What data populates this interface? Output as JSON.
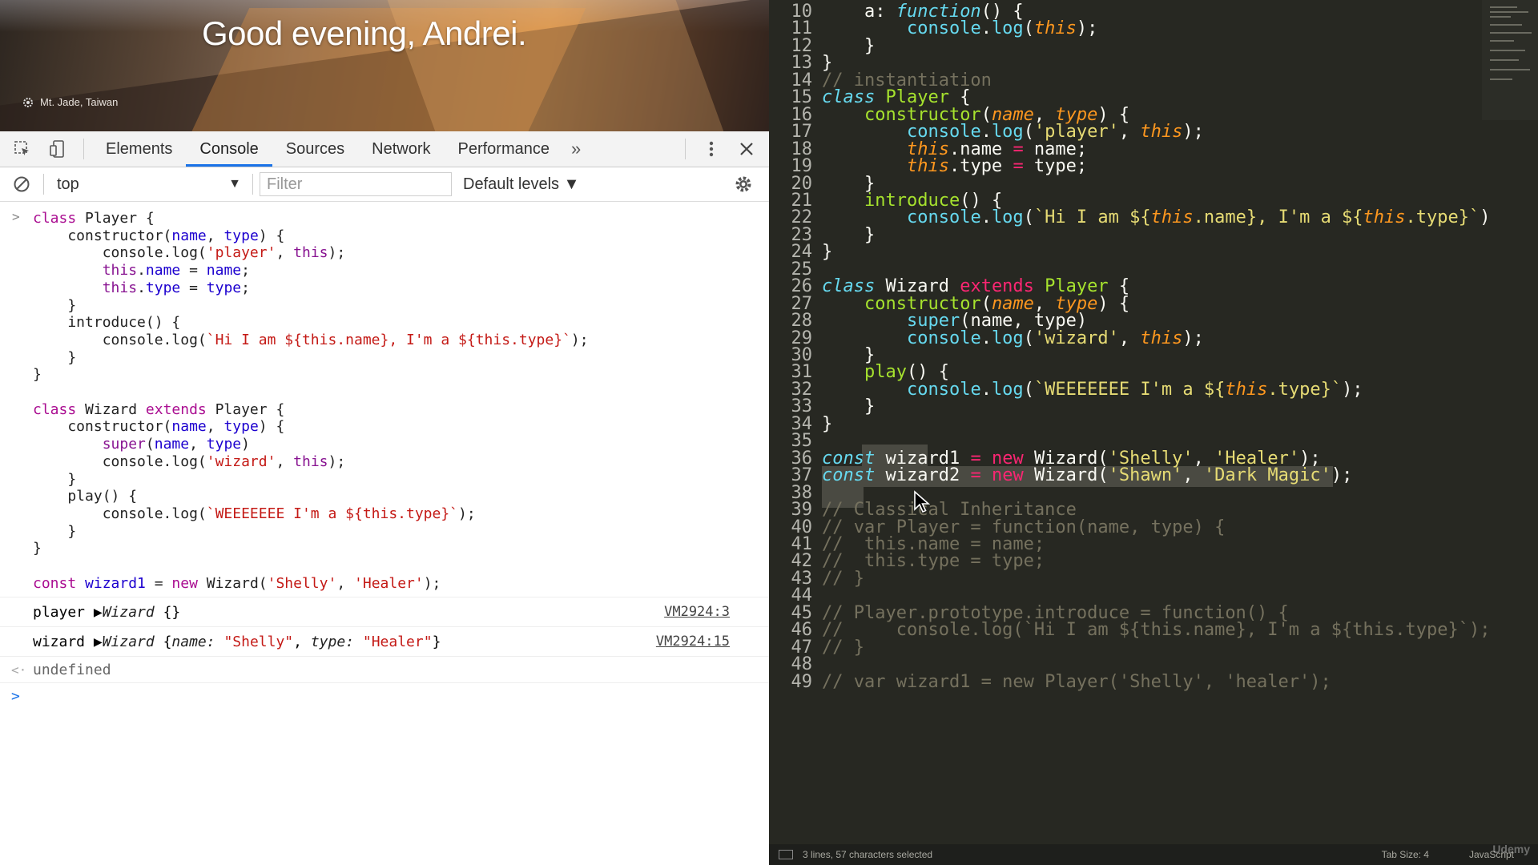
{
  "hero": {
    "greeting": "Good evening, Andrei.",
    "photo_credit": "Mt. Jade, Taiwan"
  },
  "devtools": {
    "tabs": [
      {
        "label": "Elements",
        "active": false
      },
      {
        "label": "Console",
        "active": true
      },
      {
        "label": "Sources",
        "active": false
      },
      {
        "label": "Network",
        "active": false
      },
      {
        "label": "Performance",
        "active": false
      }
    ],
    "more_tabs_glyph": "»",
    "context": "top",
    "filter_placeholder": "Filter",
    "levels": "Default levels ▼",
    "icons": [
      "inspect-icon",
      "device-toolbar-icon",
      "kebab-menu-icon",
      "close-icon",
      "clear-console-icon",
      "settings-gear-icon"
    ]
  },
  "console": {
    "input_lines": [
      "class Player {",
      "    constructor(name, type) {",
      "        console.log('player', this);",
      "        this.name = name;",
      "        this.type = type;",
      "    }",
      "    introduce() {",
      "        console.log(`Hi I am ${this.name}, I'm a ${this.type}`);",
      "    }",
      "}",
      "",
      "class Wizard extends Player {",
      "    constructor(name, type) {",
      "        super(name, type)",
      "        console.log('wizard', this);",
      "    }",
      "    play() {",
      "        console.log(`WEEEEEEE I'm a ${this.type}`);",
      "    }",
      "}",
      "",
      "const wizard1 = new Wizard('Shelly', 'Healer');"
    ],
    "logs": [
      {
        "text": "player ▶Wizard {}",
        "source": "VM2924:3"
      },
      {
        "text": "wizard ▶Wizard {name: \"Shelly\", type: \"Healer\"}",
        "source": "VM2924:15"
      }
    ],
    "return_value": "undefined"
  },
  "editor": {
    "lines": [
      {
        "n": "10",
        "text": "    a: function() {"
      },
      {
        "n": "11",
        "text": "        console.log(this);"
      },
      {
        "n": "12",
        "text": "    }"
      },
      {
        "n": "13",
        "text": "}"
      },
      {
        "n": "14",
        "text": "// instantiation"
      },
      {
        "n": "15",
        "text": "class Player {"
      },
      {
        "n": "16",
        "text": "    constructor(name, type) {"
      },
      {
        "n": "17",
        "text": "        console.log('player', this);"
      },
      {
        "n": "18",
        "text": "        this.name = name;"
      },
      {
        "n": "19",
        "text": "        this.type = type;"
      },
      {
        "n": "20",
        "text": "    }"
      },
      {
        "n": "21",
        "text": "    introduce() {"
      },
      {
        "n": "22",
        "text": "        console.log(`Hi I am ${this.name}, I'm a ${this.type}`)"
      },
      {
        "n": "23",
        "text": "    }"
      },
      {
        "n": "24",
        "text": "}"
      },
      {
        "n": "25",
        "text": ""
      },
      {
        "n": "26",
        "text": "class Wizard extends Player {"
      },
      {
        "n": "27",
        "text": "    constructor(name, type) {"
      },
      {
        "n": "28",
        "text": "        super(name, type)"
      },
      {
        "n": "29",
        "text": "        console.log('wizard', this);"
      },
      {
        "n": "30",
        "text": "    }"
      },
      {
        "n": "31",
        "text": "    play() {"
      },
      {
        "n": "32",
        "text": "        console.log(`WEEEEEEE I'm a ${this.type}`);"
      },
      {
        "n": "33",
        "text": "    }"
      },
      {
        "n": "34",
        "text": "}"
      },
      {
        "n": "35",
        "text": ""
      },
      {
        "n": "36",
        "text": "const wizard1 = new Wizard('Shelly', 'Healer');"
      },
      {
        "n": "37",
        "text": "const wizard2 = new Wizard('Shawn', 'Dark Magic');"
      },
      {
        "n": "38",
        "text": ""
      },
      {
        "n": "39",
        "text": "// Classical Inheritance"
      },
      {
        "n": "40",
        "text": "// var Player = function(name, type) {"
      },
      {
        "n": "41",
        "text": "//  this.name = name;"
      },
      {
        "n": "42",
        "text": "//  this.type = type;"
      },
      {
        "n": "43",
        "text": "// }"
      },
      {
        "n": "44",
        "text": ""
      },
      {
        "n": "45",
        "text": "// Player.prototype.introduce = function() {"
      },
      {
        "n": "46",
        "text": "//     console.log(`Hi I am ${this.name}, I'm a ${this.type}`);"
      },
      {
        "n": "47",
        "text": "// }"
      },
      {
        "n": "48",
        "text": ""
      },
      {
        "n": "49",
        "text": "// var wizard1 = new Player('Shelly', 'healer');"
      }
    ],
    "status": {
      "selection": "3 lines, 57 characters selected",
      "tab_size": "Tab Size: 4",
      "syntax": "JavaScript"
    },
    "watermark": "Udemy",
    "colors": {
      "background": "#272822",
      "keyword": "#66d9ef",
      "string": "#e6db74",
      "comment": "#75715e",
      "class_name": "#a6e22e",
      "param": "#fd971f",
      "operator": "#f92672"
    }
  }
}
